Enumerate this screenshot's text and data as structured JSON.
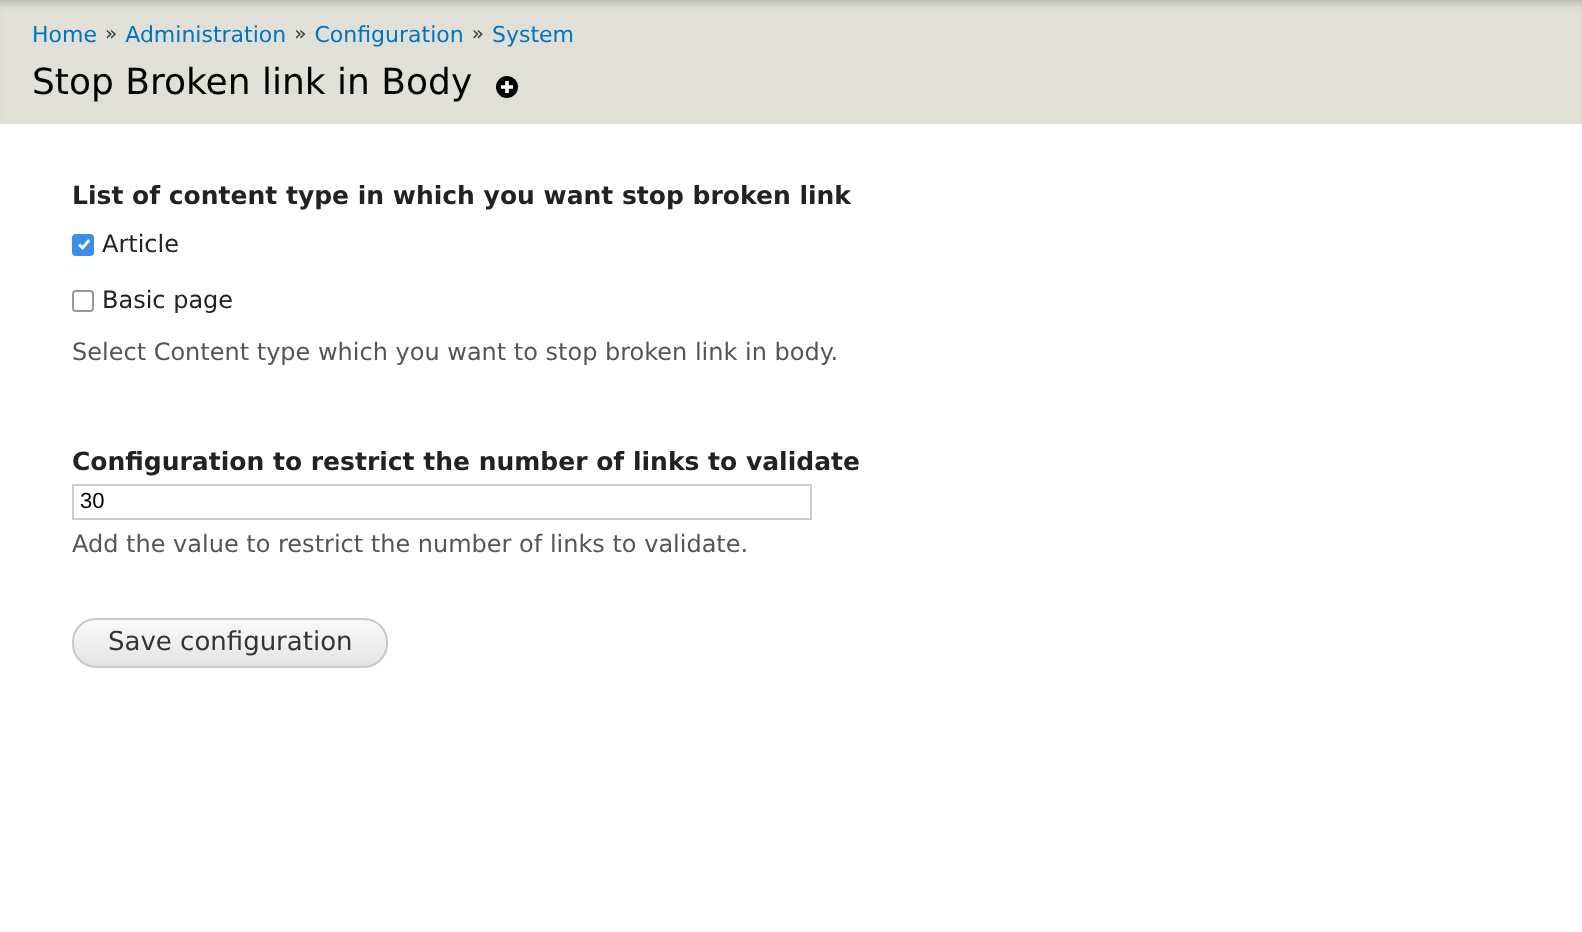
{
  "breadcrumb": [
    {
      "kind": "link",
      "text": "Home"
    },
    {
      "kind": "separator",
      "text": "»"
    },
    {
      "kind": "link",
      "text": "Administration"
    },
    {
      "kind": "separator",
      "text": "»"
    },
    {
      "kind": "link",
      "text": "Configuration"
    },
    {
      "kind": "separator",
      "text": "»"
    },
    {
      "kind": "link",
      "text": "System"
    }
  ],
  "page_title": "Stop Broken link in Body",
  "content_types": {
    "label": "List of content type in which you want stop broken link",
    "options": [
      {
        "label": "Article",
        "checked": true
      },
      {
        "label": "Basic page",
        "checked": false
      }
    ],
    "description": "Select Content type which you want to stop broken link in body."
  },
  "link_limit": {
    "label": "Configuration to restrict the number of links to validate",
    "value": "30",
    "description": "Add the value to restrict the number of links to validate."
  },
  "buttons": [
    "Save configuration"
  ]
}
